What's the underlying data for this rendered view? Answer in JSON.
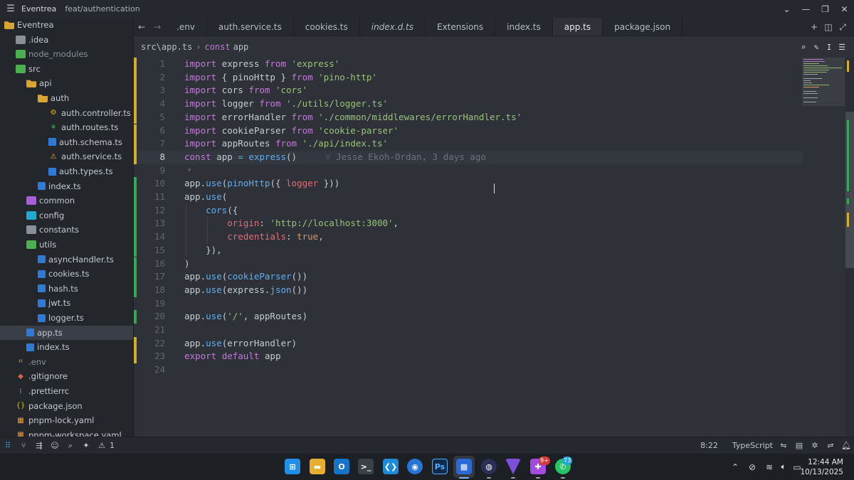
{
  "titlebar": {
    "project": "Eventrea",
    "branch": "feat/authentication"
  },
  "sidebar": {
    "items": [
      {
        "label": "Eventrea",
        "icon": "folder-open-icon"
      },
      {
        "label": ".idea",
        "icon": "folder-icon"
      },
      {
        "label": "node_modules",
        "icon": "folder-icon"
      },
      {
        "label": "src",
        "icon": "folder-open-icon"
      },
      {
        "label": "api",
        "icon": "folder-open-icon"
      },
      {
        "label": "auth",
        "icon": "folder-open-icon"
      },
      {
        "label": "auth.controller.ts",
        "icon": "gear-icon"
      },
      {
        "label": "auth.routes.ts",
        "icon": "route-icon"
      },
      {
        "label": "auth.schema.ts",
        "icon": "typescript-icon"
      },
      {
        "label": "auth.service.ts",
        "icon": "warning-icon"
      },
      {
        "label": "auth.types.ts",
        "icon": "typescript-icon"
      },
      {
        "label": "index.ts",
        "icon": "typescript-icon"
      },
      {
        "label": "common",
        "icon": "folder-icon"
      },
      {
        "label": "config",
        "icon": "folder-icon"
      },
      {
        "label": "constants",
        "icon": "folder-icon"
      },
      {
        "label": "utils",
        "icon": "folder-open-icon"
      },
      {
        "label": "asyncHandler.ts",
        "icon": "typescript-icon"
      },
      {
        "label": "cookies.ts",
        "icon": "typescript-icon"
      },
      {
        "label": "hash.ts",
        "icon": "typescript-icon"
      },
      {
        "label": "jwt.ts",
        "icon": "typescript-icon"
      },
      {
        "label": "logger.ts",
        "icon": "typescript-icon"
      },
      {
        "label": "app.ts",
        "icon": "typescript-icon"
      },
      {
        "label": "index.ts",
        "icon": "typescript-icon"
      },
      {
        "label": ".env",
        "icon": "env-icon"
      },
      {
        "label": ".gitignore",
        "icon": "git-icon"
      },
      {
        "label": ".prettierrc",
        "icon": "prettier-icon"
      },
      {
        "label": "package.json",
        "icon": "json-icon"
      },
      {
        "label": "pnpm-lock.yaml",
        "icon": "yaml-icon"
      },
      {
        "label": "pnpm-workspace.yaml",
        "icon": "yaml-icon"
      }
    ]
  },
  "tabs": [
    {
      "label": ".env"
    },
    {
      "label": "auth.service.ts"
    },
    {
      "label": "cookies.ts"
    },
    {
      "label": "index.d.ts"
    },
    {
      "label": "Extensions"
    },
    {
      "label": "index.ts"
    },
    {
      "label": "app.ts"
    },
    {
      "label": "package.json"
    }
  ],
  "breadcrumb": {
    "path": "src\\app.ts",
    "symbol_kind": "const",
    "symbol_name": "app"
  },
  "editor": {
    "blame": "Jesse Ekoh-Ordan, 3 days ago",
    "lines": [
      "import express from 'express'",
      "import { pinoHttp } from 'pino-http'",
      "import cors from 'cors'",
      "import logger from './utils/logger.ts'",
      "import errorHandler from './common/middlewares/errorHandler.ts'",
      "import cookieParser from 'cookie-parser'",
      "import appRoutes from './api/index.ts'",
      "const app = express()",
      "",
      "app.use(pinoHttp({ logger }))",
      "app.use(",
      "    cors({",
      "        origin: 'http://localhost:3000',",
      "        credentials: true,",
      "    }),",
      ")",
      "app.use(cookieParser())",
      "app.use(express.json())",
      "",
      "app.use('/', appRoutes)",
      "",
      "app.use(errorHandler)",
      "export default app",
      ""
    ]
  },
  "statusbar": {
    "problems_count": "1",
    "cursor_position": "8:22",
    "language": "TypeScript"
  },
  "taskbar": {
    "badge_1": "9+",
    "badge_2": "73",
    "time": "12:44 AM",
    "date": "10/13/2025"
  }
}
